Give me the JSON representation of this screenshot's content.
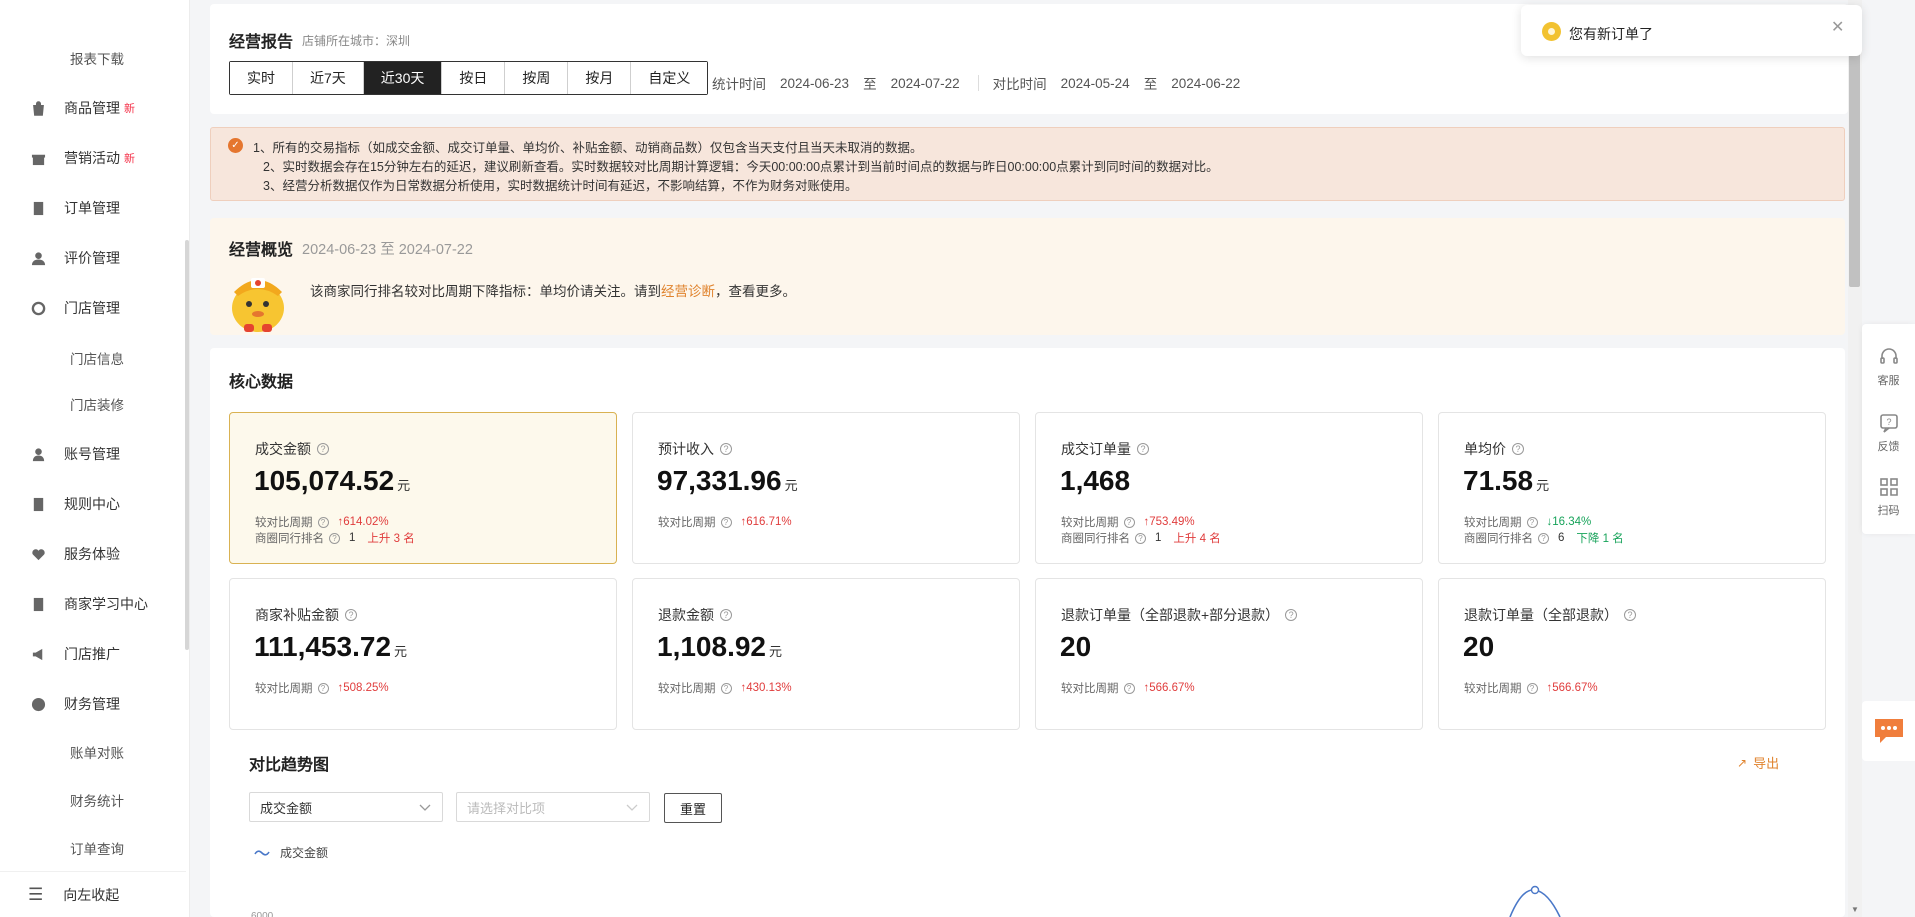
{
  "sidebar": {
    "top_partial": "",
    "report_download": "报表下载",
    "items": [
      {
        "label": "商品管理",
        "new": "新"
      },
      {
        "label": "营销活动",
        "new": "新"
      },
      {
        "label": "订单管理",
        "new": ""
      },
      {
        "label": "评价管理",
        "new": ""
      },
      {
        "label": "门店管理",
        "new": ""
      }
    ],
    "store_sub": [
      "门店信息",
      "门店装修"
    ],
    "items2": [
      {
        "label": "账号管理"
      },
      {
        "label": "规则中心"
      },
      {
        "label": "服务体验"
      },
      {
        "label": "商家学习中心"
      },
      {
        "label": "门店推广"
      },
      {
        "label": "财务管理"
      }
    ],
    "finance_sub": [
      "账单对账",
      "财务统计",
      "订单查询"
    ],
    "collapse": "向左收起"
  },
  "report": {
    "title": "经营报告",
    "city": "店铺所在城市：深圳",
    "tabs": [
      "实时",
      "近7天",
      "近30天",
      "按日",
      "按周",
      "按月",
      "自定义"
    ],
    "active_tab": "近30天",
    "stat_label": "统计时间",
    "stat_start": "2024-06-23",
    "to": "至",
    "stat_end": "2024-07-22",
    "compare_label": "对比时间",
    "compare_start": "2024-05-24",
    "compare_end": "2024-06-22"
  },
  "notice": {
    "lines": [
      "1、所有的交易指标（如成交金额、成交订单量、单均价、补贴金额、动销商品数）仅包含当天支付且当天未取消的数据。",
      "2、实时数据会存在15分钟左右的延迟，建议刷新查看。实时数据较对比周期计算逻辑：今天00:00:00点累计到当前时间点的数据与昨日00:00:00点累计到同时间的数据对比。",
      "3、经营分析数据仅作为日常数据分析使用，实时数据统计时间有延迟，不影响结算，不作为财务对账使用。"
    ]
  },
  "overview": {
    "title": "经营概览",
    "date": "2024-06-23 至 2024-07-22",
    "text_before": "该商家同行排名较对比周期下降指标：单均价请关注。请到",
    "link": "经营诊断",
    "text_after": "，查看更多。"
  },
  "core": {
    "title": "核心数据",
    "cards": [
      {
        "label": "成交金额",
        "value": "105,074.52",
        "unit": "元",
        "cmp_label": "较对比周期",
        "cmp_dir": "↑",
        "cmp_val": "614.02%",
        "rank_label": "商圈同行排名",
        "rank": "1",
        "rank_change": "上升 3 名"
      },
      {
        "label": "预计收入",
        "value": "97,331.96",
        "unit": "元",
        "cmp_label": "较对比周期",
        "cmp_dir": "↑",
        "cmp_val": "616.71%"
      },
      {
        "label": "成交订单量",
        "value": "1,468",
        "unit": "",
        "cmp_label": "较对比周期",
        "cmp_dir": "↑",
        "cmp_val": "753.49%",
        "rank_label": "商圈同行排名",
        "rank": "1",
        "rank_change": "上升 4 名"
      },
      {
        "label": "单均价",
        "value": "71.58",
        "unit": "元",
        "cmp_label": "较对比周期",
        "cmp_dir": "↓",
        "cmp_val": "16.34%",
        "rank_label": "商圈同行排名",
        "rank": "6",
        "rank_change": "下降 1 名"
      },
      {
        "label": "商家补贴金额",
        "value": "111,453.72",
        "unit": "元",
        "cmp_label": "较对比周期",
        "cmp_dir": "↑",
        "cmp_val": "508.25%"
      },
      {
        "label": "退款金额",
        "value": "1,108.92",
        "unit": "元",
        "cmp_label": "较对比周期",
        "cmp_dir": "↑",
        "cmp_val": "430.13%"
      },
      {
        "label": "退款订单量（全部退款+部分退款）",
        "value": "20",
        "unit": "",
        "cmp_label": "较对比周期",
        "cmp_dir": "↑",
        "cmp_val": "566.67%"
      },
      {
        "label": "退款订单量（全部退款）",
        "value": "20",
        "unit": "",
        "cmp_label": "较对比周期",
        "cmp_dir": "↑",
        "cmp_val": "566.67%"
      }
    ]
  },
  "trend": {
    "title": "对比趋势图",
    "export": "导出",
    "metric_select": "成交金额",
    "compare_placeholder": "请选择对比项",
    "reset": "重置",
    "legend": "成交金额",
    "y_top_tick": "6000"
  },
  "rail": {
    "service": "客服",
    "feedback": "反馈",
    "scan": "扫码"
  },
  "toast": {
    "text": "您有新订单了"
  },
  "colors": {
    "accent": "#e0832d",
    "up": "#e03c3c",
    "down": "#17a35a",
    "line": "#4a78c8"
  }
}
